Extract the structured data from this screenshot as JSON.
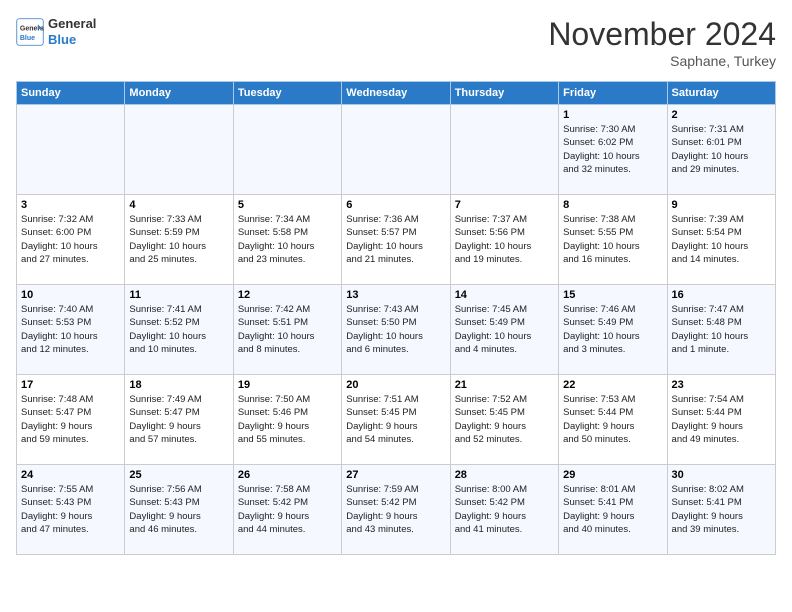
{
  "logo": {
    "line1": "General",
    "line2": "Blue"
  },
  "title": "November 2024",
  "location": "Saphane, Turkey",
  "days_header": [
    "Sunday",
    "Monday",
    "Tuesday",
    "Wednesday",
    "Thursday",
    "Friday",
    "Saturday"
  ],
  "weeks": [
    [
      {
        "num": "",
        "info": ""
      },
      {
        "num": "",
        "info": ""
      },
      {
        "num": "",
        "info": ""
      },
      {
        "num": "",
        "info": ""
      },
      {
        "num": "",
        "info": ""
      },
      {
        "num": "1",
        "info": "Sunrise: 7:30 AM\nSunset: 6:02 PM\nDaylight: 10 hours\nand 32 minutes."
      },
      {
        "num": "2",
        "info": "Sunrise: 7:31 AM\nSunset: 6:01 PM\nDaylight: 10 hours\nand 29 minutes."
      }
    ],
    [
      {
        "num": "3",
        "info": "Sunrise: 7:32 AM\nSunset: 6:00 PM\nDaylight: 10 hours\nand 27 minutes."
      },
      {
        "num": "4",
        "info": "Sunrise: 7:33 AM\nSunset: 5:59 PM\nDaylight: 10 hours\nand 25 minutes."
      },
      {
        "num": "5",
        "info": "Sunrise: 7:34 AM\nSunset: 5:58 PM\nDaylight: 10 hours\nand 23 minutes."
      },
      {
        "num": "6",
        "info": "Sunrise: 7:36 AM\nSunset: 5:57 PM\nDaylight: 10 hours\nand 21 minutes."
      },
      {
        "num": "7",
        "info": "Sunrise: 7:37 AM\nSunset: 5:56 PM\nDaylight: 10 hours\nand 19 minutes."
      },
      {
        "num": "8",
        "info": "Sunrise: 7:38 AM\nSunset: 5:55 PM\nDaylight: 10 hours\nand 16 minutes."
      },
      {
        "num": "9",
        "info": "Sunrise: 7:39 AM\nSunset: 5:54 PM\nDaylight: 10 hours\nand 14 minutes."
      }
    ],
    [
      {
        "num": "10",
        "info": "Sunrise: 7:40 AM\nSunset: 5:53 PM\nDaylight: 10 hours\nand 12 minutes."
      },
      {
        "num": "11",
        "info": "Sunrise: 7:41 AM\nSunset: 5:52 PM\nDaylight: 10 hours\nand 10 minutes."
      },
      {
        "num": "12",
        "info": "Sunrise: 7:42 AM\nSunset: 5:51 PM\nDaylight: 10 hours\nand 8 minutes."
      },
      {
        "num": "13",
        "info": "Sunrise: 7:43 AM\nSunset: 5:50 PM\nDaylight: 10 hours\nand 6 minutes."
      },
      {
        "num": "14",
        "info": "Sunrise: 7:45 AM\nSunset: 5:49 PM\nDaylight: 10 hours\nand 4 minutes."
      },
      {
        "num": "15",
        "info": "Sunrise: 7:46 AM\nSunset: 5:49 PM\nDaylight: 10 hours\nand 3 minutes."
      },
      {
        "num": "16",
        "info": "Sunrise: 7:47 AM\nSunset: 5:48 PM\nDaylight: 10 hours\nand 1 minute."
      }
    ],
    [
      {
        "num": "17",
        "info": "Sunrise: 7:48 AM\nSunset: 5:47 PM\nDaylight: 9 hours\nand 59 minutes."
      },
      {
        "num": "18",
        "info": "Sunrise: 7:49 AM\nSunset: 5:47 PM\nDaylight: 9 hours\nand 57 minutes."
      },
      {
        "num": "19",
        "info": "Sunrise: 7:50 AM\nSunset: 5:46 PM\nDaylight: 9 hours\nand 55 minutes."
      },
      {
        "num": "20",
        "info": "Sunrise: 7:51 AM\nSunset: 5:45 PM\nDaylight: 9 hours\nand 54 minutes."
      },
      {
        "num": "21",
        "info": "Sunrise: 7:52 AM\nSunset: 5:45 PM\nDaylight: 9 hours\nand 52 minutes."
      },
      {
        "num": "22",
        "info": "Sunrise: 7:53 AM\nSunset: 5:44 PM\nDaylight: 9 hours\nand 50 minutes."
      },
      {
        "num": "23",
        "info": "Sunrise: 7:54 AM\nSunset: 5:44 PM\nDaylight: 9 hours\nand 49 minutes."
      }
    ],
    [
      {
        "num": "24",
        "info": "Sunrise: 7:55 AM\nSunset: 5:43 PM\nDaylight: 9 hours\nand 47 minutes."
      },
      {
        "num": "25",
        "info": "Sunrise: 7:56 AM\nSunset: 5:43 PM\nDaylight: 9 hours\nand 46 minutes."
      },
      {
        "num": "26",
        "info": "Sunrise: 7:58 AM\nSunset: 5:42 PM\nDaylight: 9 hours\nand 44 minutes."
      },
      {
        "num": "27",
        "info": "Sunrise: 7:59 AM\nSunset: 5:42 PM\nDaylight: 9 hours\nand 43 minutes."
      },
      {
        "num": "28",
        "info": "Sunrise: 8:00 AM\nSunset: 5:42 PM\nDaylight: 9 hours\nand 41 minutes."
      },
      {
        "num": "29",
        "info": "Sunrise: 8:01 AM\nSunset: 5:41 PM\nDaylight: 9 hours\nand 40 minutes."
      },
      {
        "num": "30",
        "info": "Sunrise: 8:02 AM\nSunset: 5:41 PM\nDaylight: 9 hours\nand 39 minutes."
      }
    ]
  ]
}
